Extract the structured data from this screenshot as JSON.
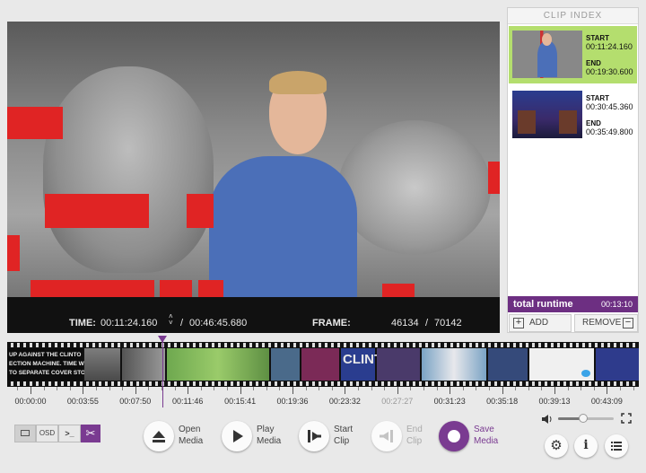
{
  "video": {
    "time_label": "TIME:",
    "current_time": "00:11:24.160",
    "separator": "/",
    "total_time": "00:46:45.680",
    "frame_label": "FRAME:",
    "current_frame": "46134",
    "frame_separator": "/",
    "total_frames": "70142"
  },
  "clip_index": {
    "title": "CLIP INDEX",
    "clips": [
      {
        "start_label": "START",
        "start": "00:11:24.160",
        "end_label": "END",
        "end": "00:19:30.600",
        "selected": true
      },
      {
        "start_label": "START",
        "start": "00:30:45.360",
        "end_label": "END",
        "end": "00:35:49.800",
        "selected": false
      }
    ],
    "total_runtime_label": "total runtime",
    "total_runtime": "00:13:10",
    "add_label": "ADD",
    "remove_label": "REMOVE"
  },
  "filmstrip": {
    "overlay_lines": [
      "UP AGAINST THE CLINTO",
      "ECTION MACHINE. TIME WRO",
      "TO SEPARATE COVER STORIE"
    ],
    "clint_text": "CLINT"
  },
  "timeline": {
    "ticks": [
      {
        "label": "00:00:00",
        "dim": false
      },
      {
        "label": "00:03:55",
        "dim": false
      },
      {
        "label": "00:07:50",
        "dim": false
      },
      {
        "label": "00:11:46",
        "dim": false
      },
      {
        "label": "00:15:41",
        "dim": false
      },
      {
        "label": "00:19:36",
        "dim": false
      },
      {
        "label": "00:23:32",
        "dim": false
      },
      {
        "label": "00:27:27",
        "dim": true
      },
      {
        "label": "00:31:23",
        "dim": false
      },
      {
        "label": "00:35:18",
        "dim": false
      },
      {
        "label": "00:39:13",
        "dim": false
      },
      {
        "label": "00:43:09",
        "dim": false
      }
    ],
    "playhead_fraction": 0.244
  },
  "controls": {
    "osd_label": "OSD",
    "terminal_label": ">_",
    "open_media": [
      "Open",
      "Media"
    ],
    "play_media": [
      "Play",
      "Media"
    ],
    "start_clip": [
      "Start",
      "Clip"
    ],
    "end_clip": [
      "End",
      "Clip"
    ],
    "save_media": [
      "Save",
      "Media"
    ],
    "volume_fraction": 0.45
  },
  "colors": {
    "accent": "#7a3b91",
    "selected_clip": "#b4de6e",
    "runtime_bar": "#6d2f82"
  },
  "icons": [
    "eject-icon",
    "play-icon",
    "start-clip-icon",
    "end-clip-icon",
    "save-record-icon",
    "volume-icon",
    "fullscreen-icon",
    "gear-icon",
    "info-icon",
    "list-icon",
    "scissors-icon",
    "plus-icon",
    "minus-icon"
  ]
}
